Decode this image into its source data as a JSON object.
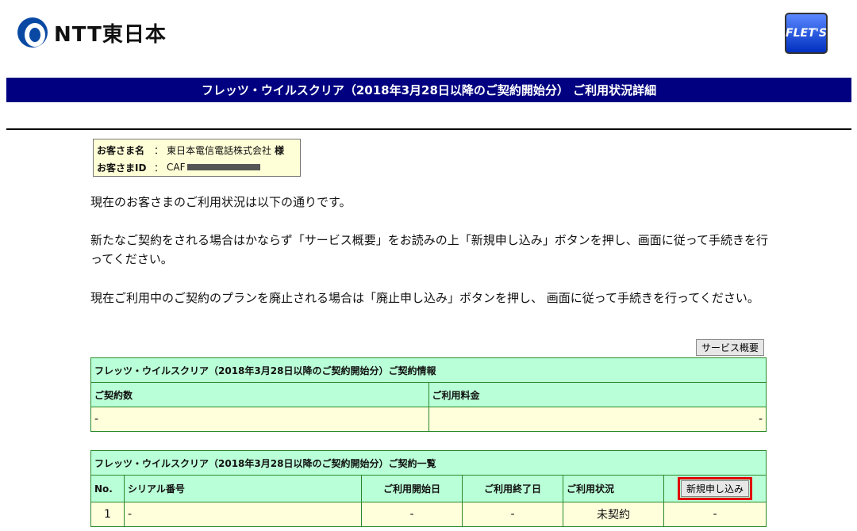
{
  "header": {
    "logo_text": "NTT東日本",
    "flets_label": "FLET'S",
    "title": "フレッツ・ウイルスクリア（2018年3月28日以降のご契約開始分） ご利用状況詳細"
  },
  "customer": {
    "name_label": "お客さま名",
    "name_value": "東日本電信電話株式会社",
    "name_suffix": "様",
    "id_label": "お客さまID",
    "id_value": "CAF",
    "colon": "："
  },
  "messages": [
    "現在のお客さまのご利用状況は以下の通りです。",
    "新たなご契約をされる場合はかならず「サービス概要」をお読みの上「新規申し込み」ボタンを押し、画面に従って手続きを行ってください。",
    "現在ご利用中のご契約のプランを廃止される場合は「廃止申し込み」ボタンを押し、 画面に従って手続きを行ってください。"
  ],
  "service_overview_button": "サービス概要",
  "contract_info": {
    "title": "フレッツ・ウイルスクリア（2018年3月28日以降のご契約開始分）ご契約情報",
    "col_count": "ご契約数",
    "col_fee": "ご利用料金",
    "count_value": "-",
    "fee_value": "-"
  },
  "contract_list": {
    "title": "フレッツ・ウイルスクリア（2018年3月28日以降のご契約開始分）ご契約一覧",
    "headers": [
      "No.",
      "シリアル番号",
      "ご利用開始日",
      "ご利用終了日",
      "ご利用状況"
    ],
    "new_button": "新規申し込み",
    "rows": [
      {
        "no": "1",
        "serial": "-",
        "start": "-",
        "end": "-",
        "status": "未契約",
        "action": "-"
      }
    ]
  }
}
